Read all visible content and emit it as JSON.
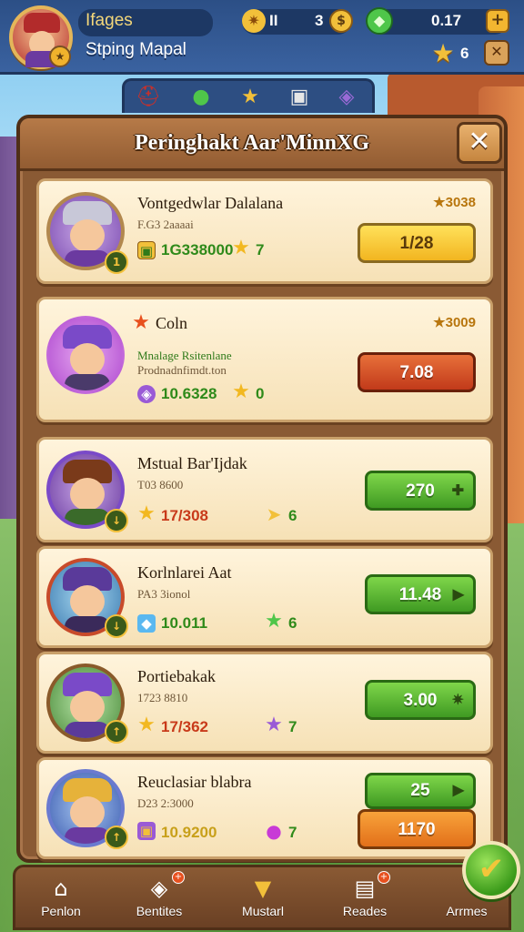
{
  "hud": {
    "player_name": "Ifages",
    "location": "Stping Mapal",
    "resource_1_value": "II",
    "resource_2_value": "3",
    "gems_value": "0.17",
    "stars_value": "6"
  },
  "panel": {
    "title": "Peringhakt Aar'MinnXG"
  },
  "cards": [
    {
      "name": "Vontgedwlar Dalalana",
      "desc": "F.G3 2aaaai",
      "stat_value": "1G338000",
      "stat_value_2": "7",
      "star_value": "3038",
      "button_label": "1/28",
      "button_style": "yellow",
      "level": "1"
    },
    {
      "name": "Coln",
      "desc": "Mnalage Rsitenlane",
      "desc_2": "Prodnadnfimdt.ton",
      "stat_value": "10.6328",
      "stat_value_2": "0",
      "star_value": "3009",
      "button_label": "7.08",
      "button_style": "red",
      "level": ""
    },
    {
      "name": "Mstual Bar'Ijdak",
      "desc": "T03 8600",
      "stat_value": "17/308",
      "stat_value_2": "6",
      "star_value": "",
      "button_label": "270",
      "button_style": "green",
      "level": ""
    },
    {
      "name": "Korlnlarei Aat",
      "desc": "PA3 3ionol",
      "stat_value": "10.011",
      "stat_value_2": "6",
      "star_value": "",
      "button_label": "11.48",
      "button_style": "green",
      "level": ""
    },
    {
      "name": "Portiebakak",
      "desc": "1723 8810",
      "stat_value": "17/362",
      "stat_value_2": "7",
      "star_value": "",
      "button_label": "3.00",
      "button_style": "green",
      "level": ""
    },
    {
      "name": "Reuclasiar blabra",
      "desc": "D23 2:3000",
      "stat_value": "10.9200",
      "stat_value_2": "7",
      "star_value": "",
      "button_label": "25",
      "button_label_2": "1170",
      "button_style": "green",
      "level": ""
    }
  ],
  "bottom_nav": [
    {
      "label": "Penlon",
      "icon": "house-icon"
    },
    {
      "label": "Bentites",
      "icon": "gem-box-icon"
    },
    {
      "label": "Mustarl",
      "icon": "trophy-icon"
    },
    {
      "label": "Reades",
      "icon": "scroll-icon"
    },
    {
      "label": "Arrmes",
      "icon": "checkmark-icon"
    }
  ]
}
